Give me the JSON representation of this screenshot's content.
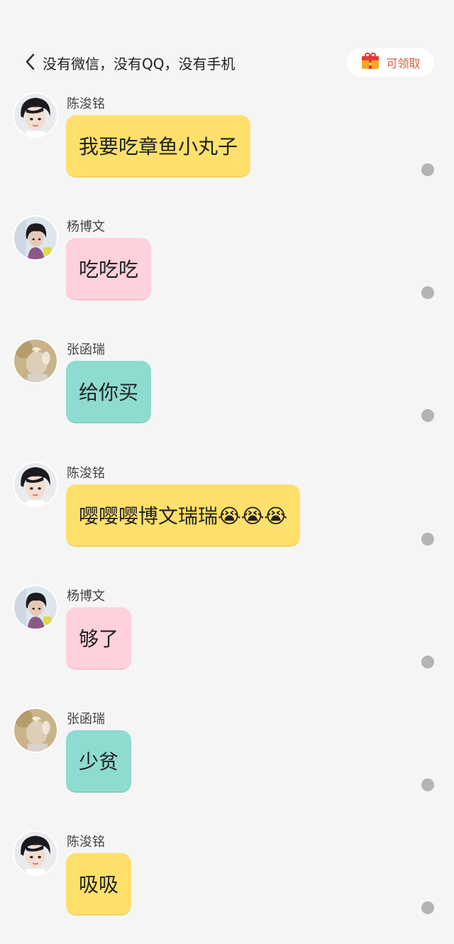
{
  "header": {
    "title": "没有微信，没有QQ，没有手机",
    "reward_label": "可领取"
  },
  "colors": {
    "yellow": "#ffe06b",
    "pink": "#ffd1dc",
    "teal": "#8edbd0",
    "reward": "#d85a40",
    "dot": "#b4b4b4"
  },
  "messages": [
    {
      "sender": "陈浚铭",
      "text": "我要吃章鱼小丸子",
      "bubble_color": "yellow",
      "avatar": "avatar-chen"
    },
    {
      "sender": "杨博文",
      "text": "吃吃吃",
      "bubble_color": "pink",
      "avatar": "avatar-yang"
    },
    {
      "sender": "张函瑞",
      "text": "给你买",
      "bubble_color": "teal",
      "avatar": "avatar-zhang"
    },
    {
      "sender": "陈浚铭",
      "text": "嘤嘤嘤博文瑞瑞😭😭😭",
      "bubble_color": "yellow",
      "avatar": "avatar-chen"
    },
    {
      "sender": "杨博文",
      "text": "够了",
      "bubble_color": "pink",
      "avatar": "avatar-yang"
    },
    {
      "sender": "张函瑞",
      "text": "少贫",
      "bubble_color": "teal",
      "avatar": "avatar-zhang"
    },
    {
      "sender": "陈浚铭",
      "text": "吸吸",
      "bubble_color": "yellow",
      "avatar": "avatar-chen"
    }
  ]
}
